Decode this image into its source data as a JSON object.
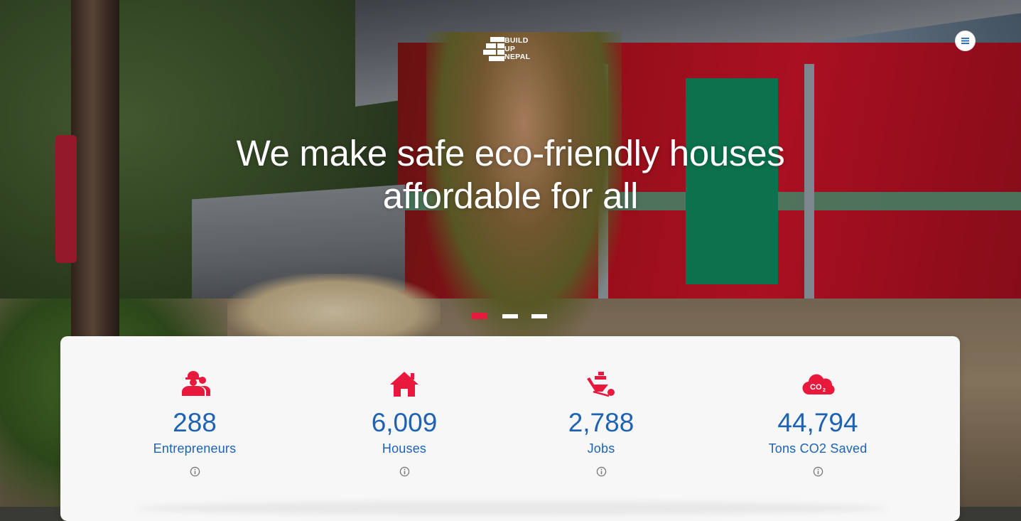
{
  "header": {
    "logo_lines": [
      "BUILD",
      "UP",
      "NEPAL"
    ],
    "menu_icon": "hamburger-menu-icon"
  },
  "hero": {
    "headline_line1": "We make safe eco-friendly houses",
    "headline_line2": "affordable for all",
    "slides_count": 3,
    "active_slide": 1
  },
  "stats": [
    {
      "icon": "workers-icon",
      "value": "288",
      "label": "Entrepreneurs"
    },
    {
      "icon": "house-icon",
      "value": "6,009",
      "label": "Houses"
    },
    {
      "icon": "wheelbarrow-icon",
      "value": "2,788",
      "label": "Jobs"
    },
    {
      "icon": "co2-cloud-icon",
      "value": "44,794",
      "label": "Tons CO2 Saved"
    }
  ],
  "colors": {
    "accent_red": "#e8193c",
    "stat_blue": "#1e63b3",
    "card_bg": "#f7f7f7"
  }
}
